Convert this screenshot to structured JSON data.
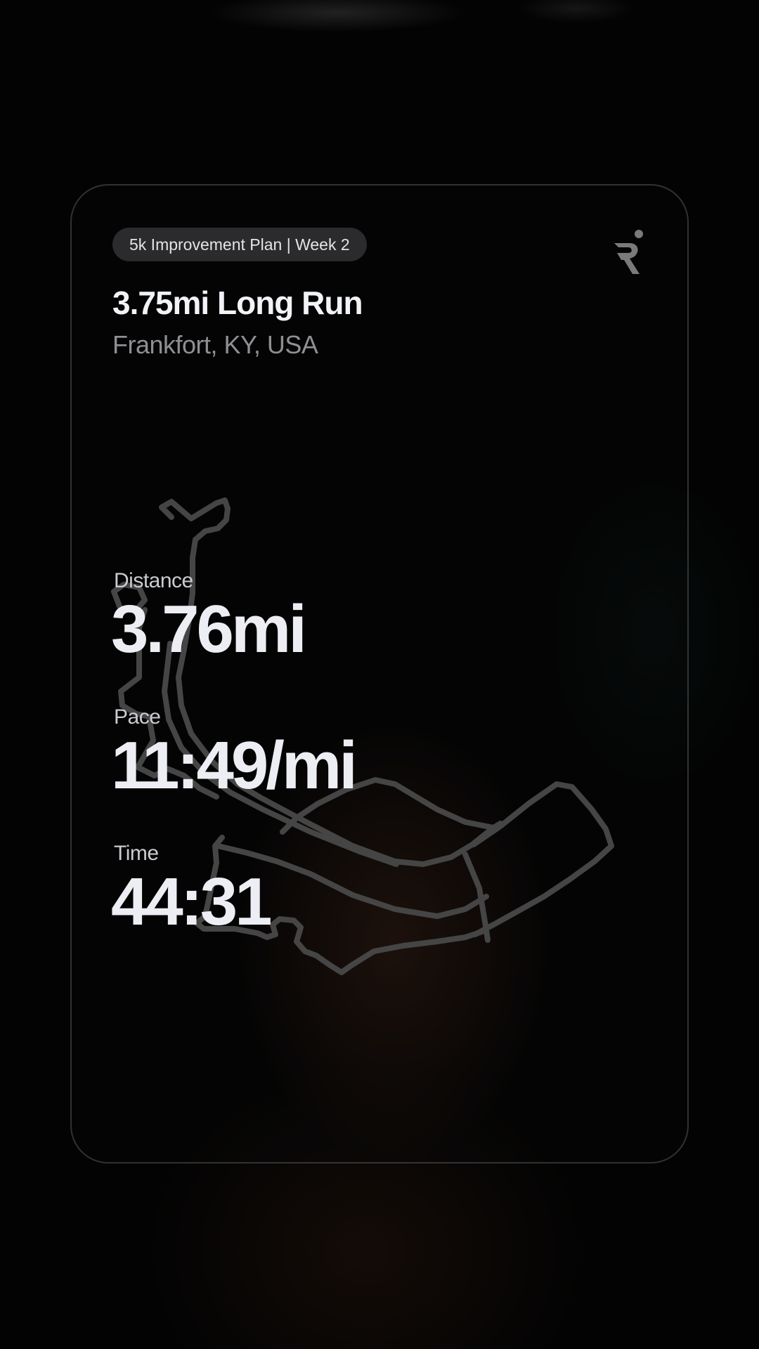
{
  "card": {
    "plan_label": "5k Improvement Plan | Week 2",
    "title": "3.75mi Long Run",
    "location": "Frankfort, KY, USA",
    "logo_icon": "runna-logo-icon",
    "route_icon": "route-map-icon"
  },
  "stats": [
    {
      "label": "Distance",
      "value": "3.76mi"
    },
    {
      "label": "Pace",
      "value": "11:49/mi"
    },
    {
      "label": "Time",
      "value": "44:31"
    }
  ],
  "colors": {
    "background": "#030303",
    "text_primary": "#eceef3",
    "text_secondary": "#8e8f93",
    "pill_background": "#2b2b2d",
    "route_stroke": "#454545"
  }
}
